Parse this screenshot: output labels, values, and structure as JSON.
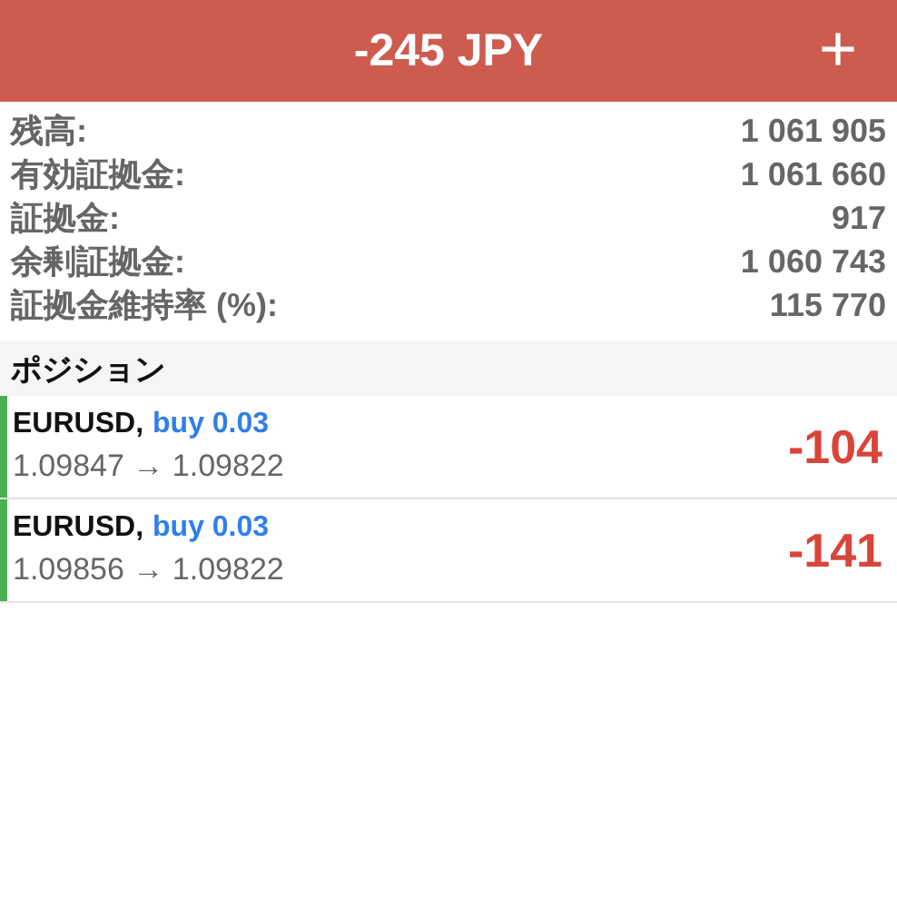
{
  "header": {
    "title": "-245 JPY",
    "add_icon": "+"
  },
  "summary": [
    {
      "label": "残高:",
      "value": "1 061 905"
    },
    {
      "label": "有効証拠金:",
      "value": "1 061 660"
    },
    {
      "label": "証拠金:",
      "value": "917"
    },
    {
      "label": "余剰証拠金:",
      "value": "1 060 743"
    },
    {
      "label": "証拠金維持率 (%):",
      "value": "115 770"
    }
  ],
  "positions_section": {
    "title": "ポジション"
  },
  "positions": [
    {
      "symbol": "EURUSD,",
      "side": "buy 0.03",
      "prices": "1.09847 → 1.09822",
      "profit": "-104",
      "color": "#4caf50"
    },
    {
      "symbol": "EURUSD,",
      "side": "buy 0.03",
      "prices": "1.09856 → 1.09822",
      "profit": "-141",
      "color": "#4caf50"
    }
  ]
}
